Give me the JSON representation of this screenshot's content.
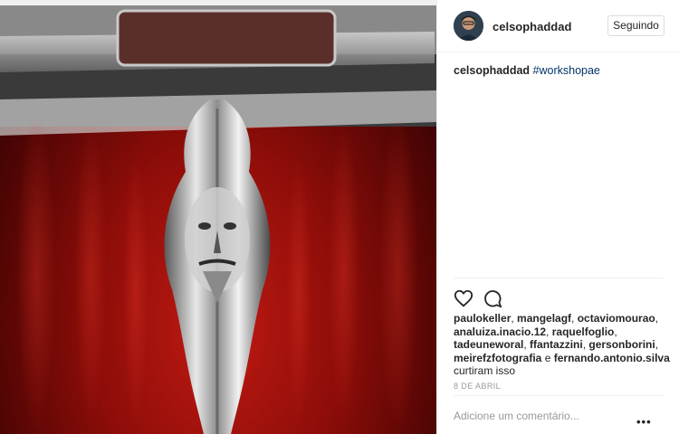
{
  "photo": {
    "subject": "hood-ornament-photo"
  },
  "header": {
    "username": "celsophaddad",
    "follow_label": "Seguindo"
  },
  "caption": {
    "username": "celsophaddad",
    "hashtag": "#workshopae"
  },
  "icons": {
    "like": "heart-icon",
    "comment": "comment-bubble-icon",
    "more": "ellipsis-icon"
  },
  "likes": {
    "names": [
      "paulokeller",
      "mangelagf",
      "octaviomourao",
      "analuiza.inacio.12",
      "raquelfoglio",
      "tadeuneworal",
      "ffantazzini",
      "gersonborini",
      "meirefzfotografia"
    ],
    "conjunction": "e",
    "last_name": "fernando.antonio.silva",
    "suffix": "curtiram isso"
  },
  "date": "8 DE ABRIL",
  "comment": {
    "placeholder": "Adicione um comentário..."
  },
  "colors": {
    "hashtag": "#003569",
    "border": "#efefef",
    "muted": "#999999"
  }
}
